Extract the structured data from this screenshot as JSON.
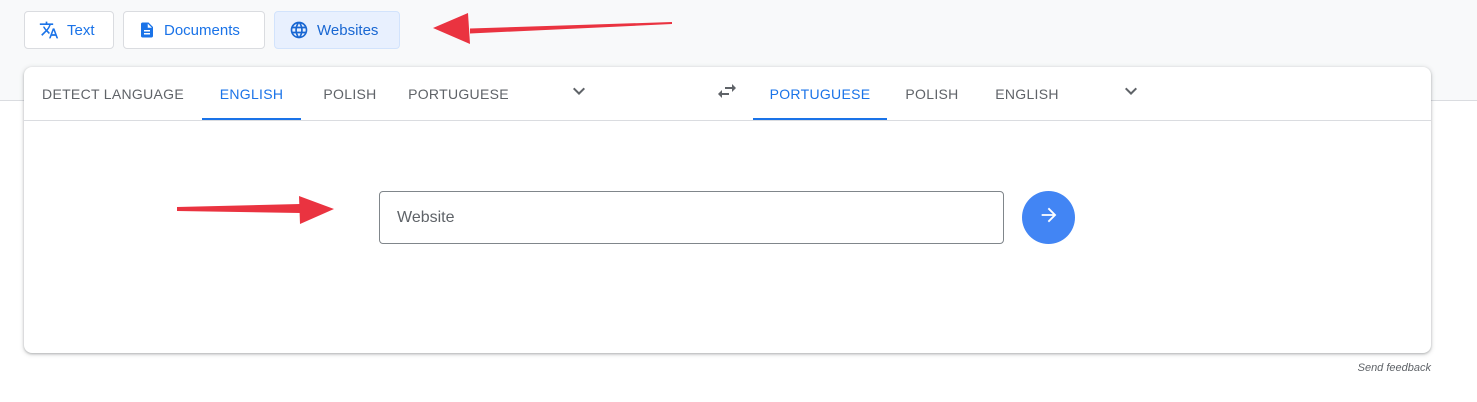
{
  "modes": [
    {
      "label": "Text",
      "icon": "translate-icon",
      "active": false
    },
    {
      "label": "Documents",
      "icon": "document-icon",
      "active": false
    },
    {
      "label": "Websites",
      "icon": "globe-icon",
      "active": true
    }
  ],
  "source_languages": [
    "DETECT LANGUAGE",
    "ENGLISH",
    "POLISH",
    "PORTUGUESE"
  ],
  "source_active": "ENGLISH",
  "target_languages": [
    "PORTUGUESE",
    "POLISH",
    "ENGLISH"
  ],
  "target_active": "PORTUGUESE",
  "icons": {
    "source_more": "chevron-down-icon",
    "swap": "swap-icon",
    "target_more": "chevron-down-icon",
    "submit": "arrow-right-icon"
  },
  "website_input": {
    "placeholder": "Website",
    "value": ""
  },
  "feedback_label": "Send feedback",
  "colors": {
    "accent": "#1a73e8",
    "active_chip_bg": "#e8f0fe",
    "go_button": "#4285f4",
    "annotation_arrow": "#ea3340"
  }
}
